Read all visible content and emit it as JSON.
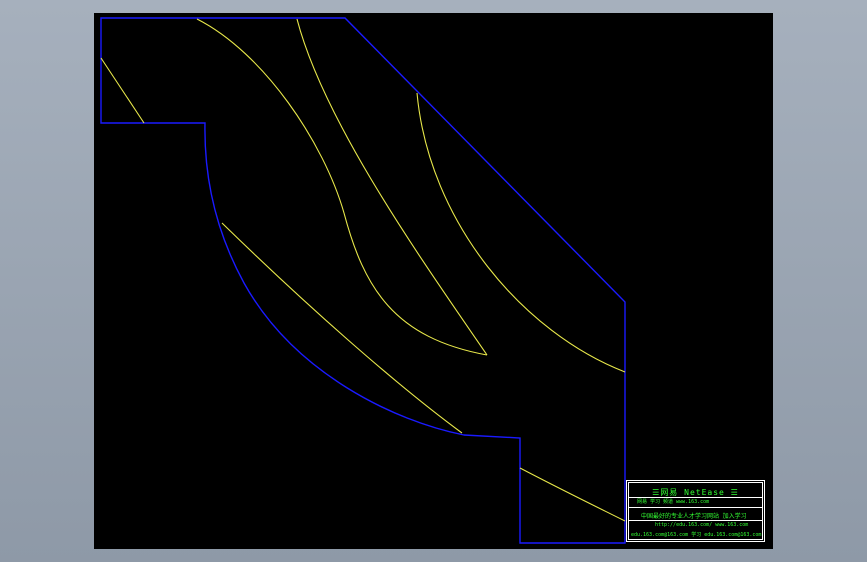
{
  "colors": {
    "background": "#000000",
    "outline": "#1a1aff",
    "blades": "#e8e84a",
    "title_block_text": "#33ff33",
    "title_block_border": "#ffffff"
  },
  "title_block": {
    "brand": "☰网易 NetEase ☰",
    "line2": "网易 学习 频道              www.163.com",
    "line3": "中国最好的专业人才学习网站 加入学习",
    "line4": "http://edu.163.com/ www.163.com",
    "line5": "edu.163.com@163.com 学习 edu.163.com@163.com"
  }
}
